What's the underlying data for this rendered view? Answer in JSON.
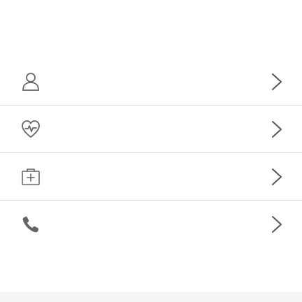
{
  "colors": {
    "icon_stroke": "#666666",
    "chevron_stroke": "#555555",
    "divider": "#dcdcdc",
    "background": "#ffffff"
  },
  "menu": {
    "items": [
      {
        "icon": "user-icon",
        "label": "",
        "chevron": "chevron-right-icon"
      },
      {
        "icon": "heart-pulse-icon",
        "label": "",
        "chevron": "chevron-right-icon"
      },
      {
        "icon": "medical-kit-icon",
        "label": "",
        "chevron": "chevron-right-icon"
      },
      {
        "icon": "phone-icon",
        "label": "",
        "chevron": "chevron-right-icon"
      }
    ]
  }
}
